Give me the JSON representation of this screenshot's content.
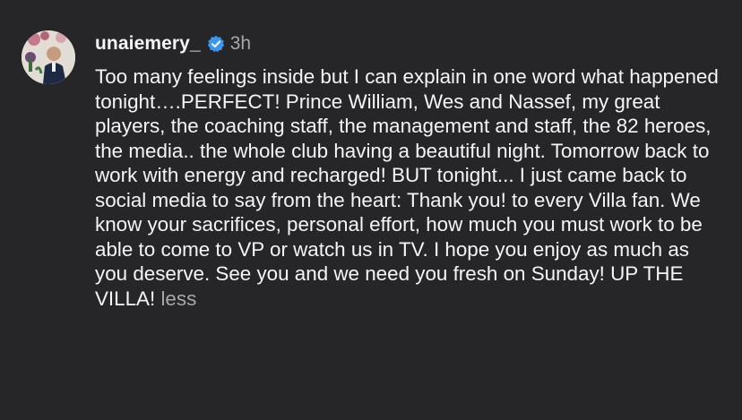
{
  "comment": {
    "username": "unaiemery_",
    "timestamp": "3h",
    "text": "Too many feelings inside but I can explain in one word what happened tonight….PERFECT! Prince William, Wes and Nassef, my great players, the coaching staff, the management and staff, the 82 heroes, the media.. the whole club having a beautiful night. Tomorrow back to work with energy and recharged! BUT tonight... I just came back to social media to say from the heart: Thank you! to every Villa fan. We know your sacrifices, personal effort, how much you must work to be able to come to VP or watch us in TV.  I hope you enjoy as much as you deserve. See you and we need you fresh on Sunday! UP THE VILLA!",
    "less_label": "less",
    "verified_icon": "verified-badge-icon",
    "verified_color": "#3897f0"
  }
}
